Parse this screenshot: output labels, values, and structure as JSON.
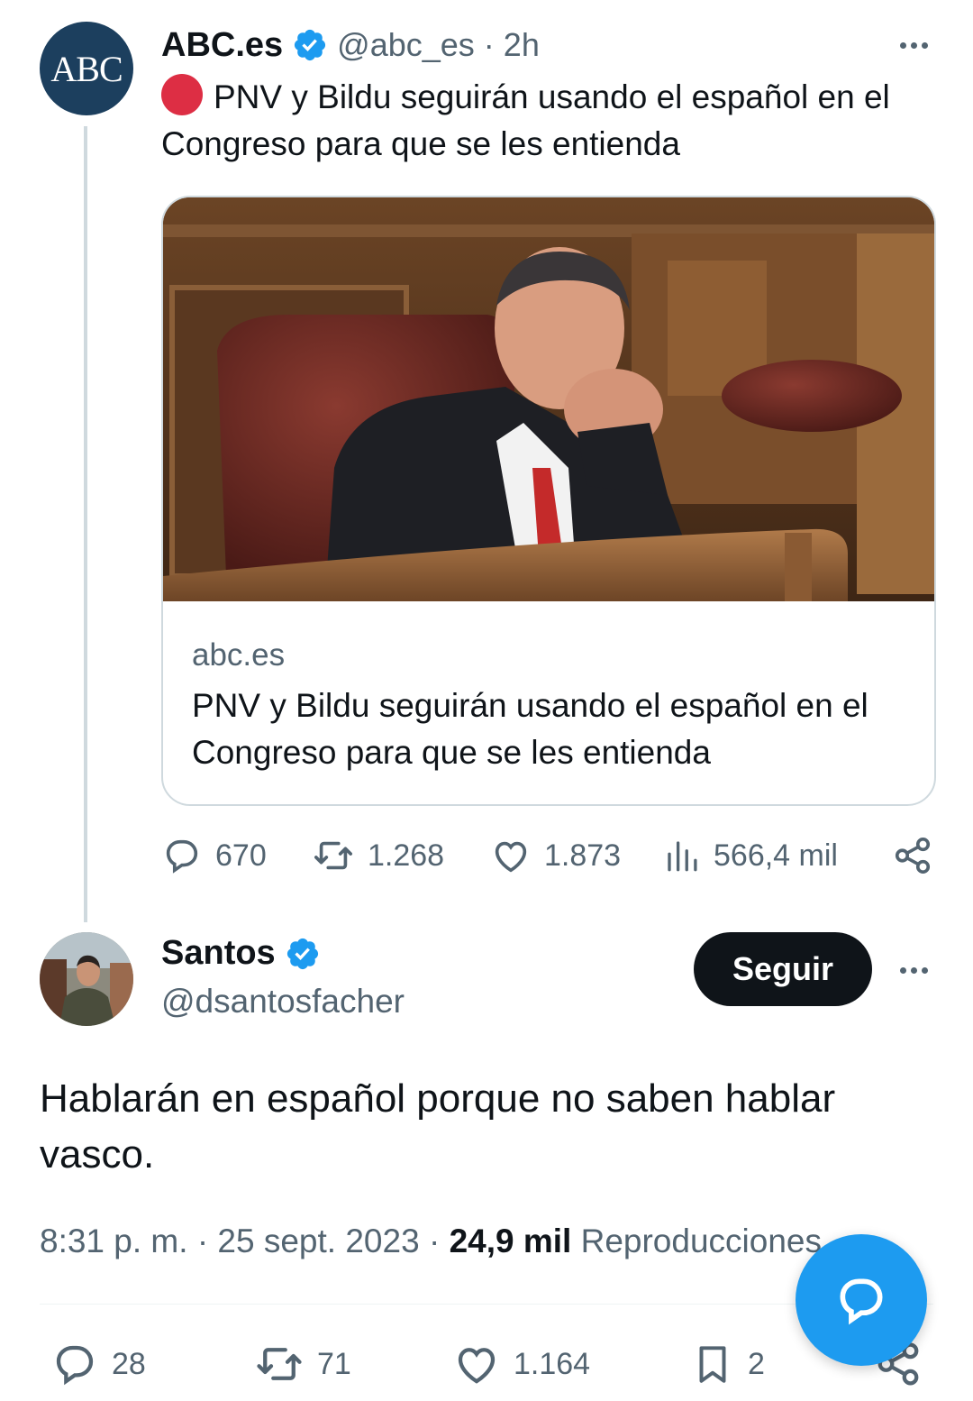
{
  "original_tweet": {
    "avatar_text": "ABC",
    "name": "ABC.es",
    "handle": "@abc_es",
    "separator": "·",
    "time": "2h",
    "text": "PNV y Bildu seguirán usando el español en el Congreso para que se les entienda",
    "card": {
      "domain": "abc.es",
      "title": "PNV y Bildu seguirán usando el español en el Congreso para que se les entienda"
    },
    "actions": {
      "replies": "670",
      "retweets": "1.268",
      "likes": "1.873",
      "views": "566,4 mil"
    }
  },
  "reply_tweet": {
    "name": "Santos",
    "handle": "@dsantosfacher",
    "follow_label": "Seguir",
    "text": "Hablarán en español porque no saben hablar vasco.",
    "time": "8:31 p. m.",
    "date": "25 sept. 2023",
    "views_count": "24,9 mil",
    "views_label": "Reproducciones",
    "actions": {
      "replies": "28",
      "retweets": "71",
      "likes": "1.164",
      "bookmarks": "2"
    }
  },
  "icons": {
    "verified": "verified-badge-icon",
    "reply": "reply-icon",
    "retweet": "retweet-icon",
    "like": "heart-icon",
    "views": "views-icon",
    "share": "share-icon",
    "bookmark": "bookmark-icon",
    "compose": "compose-reply-icon"
  },
  "colors": {
    "accent": "#1d9bf0",
    "text": "#0f1419",
    "muted": "#536471",
    "breaking_dot": "#dd2e44",
    "abc_avatar": "#1c3f5e"
  }
}
